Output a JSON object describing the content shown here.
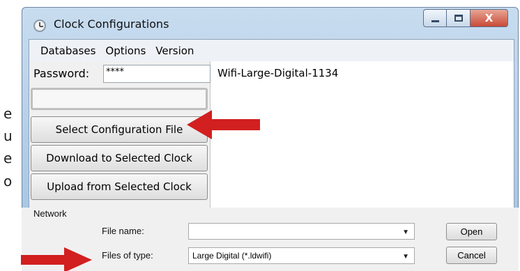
{
  "background_fragments": [
    "e",
    "u",
    "e",
    "o"
  ],
  "window": {
    "title": "Clock Configurations",
    "controls": {
      "minimize_icon": "minimize-icon",
      "maximize_icon": "maximize-icon",
      "close_glyph": "X"
    }
  },
  "menubar": {
    "items": [
      "Databases",
      "Options",
      "Version"
    ]
  },
  "left_panel": {
    "password_label": "Password:",
    "password_value": "****",
    "blank_field_value": "",
    "buttons": [
      "Select Configuration File",
      "Download to Selected Clock",
      "Upload from Selected Clock"
    ]
  },
  "listbox": {
    "items": [
      "Wifi-Large-Digital-1134"
    ]
  },
  "file_dialog": {
    "network_label": "Network",
    "file_name_label": "File name:",
    "file_name_value": "",
    "files_of_type_label": "Files of type:",
    "files_of_type_value": "Large Digital (*.ldwifi)",
    "open_label": "Open",
    "cancel_label": "Cancel"
  },
  "colors": {
    "accent_arrow": "#d21f1f",
    "title_bar": "#b6cfe8",
    "close_button": "#c84a36"
  }
}
